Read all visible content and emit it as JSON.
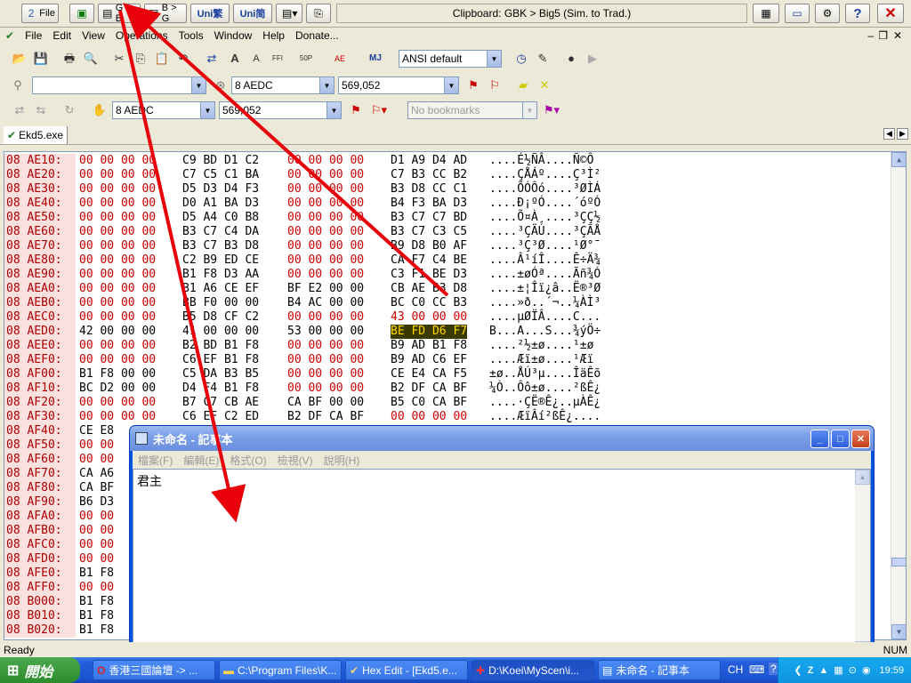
{
  "top_toolbar": {
    "buttons": [
      "File",
      "",
      "G > B",
      "B > G",
      "Uni繁",
      "Uni简",
      "",
      ""
    ],
    "clipboard_text": "Clipboard: GBK > Big5  (Sim. to Trad.)"
  },
  "menu": {
    "items": [
      "File",
      "Edit",
      "View",
      "Operations",
      "Tools",
      "Window",
      "Help",
      "Donate..."
    ]
  },
  "toolbar2": {
    "font_select": "ANSI default"
  },
  "toolbar3": {
    "combo1": "",
    "combo2": "8 AEDC",
    "combo3": "569,052"
  },
  "toolbar4": {
    "combo1": "8 AEDC",
    "combo2": "569,052",
    "bookmarks": "No bookmarks"
  },
  "tab": {
    "label": "Ekd5.exe"
  },
  "hex": {
    "rows": [
      {
        "addr": "08 AE10:",
        "g1": "00 00 00 00",
        "g2": "C9 BD D1 C2",
        "g3": "00 00 00 00",
        "g4": "D1 A9 D4 AD",
        "ascii": "....É½ÑÂ....Ñ©Ô­"
      },
      {
        "addr": "08 AE20:",
        "g1": "00 00 00 00",
        "g2": "C7 C5 C1 BA",
        "g3": "00 00 00 00",
        "g4": "C7 B3 CC B2",
        "ascii": "....ÇÅÁº....Ç³Ì²"
      },
      {
        "addr": "08 AE30:",
        "g1": "00 00 00 00",
        "g2": "D5 D3 D4 F3",
        "g3": "00 00 00 00",
        "g4": "B3 D8 CC C1",
        "ascii": "....ÕÓÔó....³ØÌÁ"
      },
      {
        "addr": "08 AE40:",
        "g1": "00 00 00 00",
        "g2": "D0 A1 BA D3",
        "g3": "00 00 00 00",
        "g4": "B4 F3 BA D3",
        "ascii": "....Ð¡ºÓ....´óºÓ"
      },
      {
        "addr": "08 AE50:",
        "g1": "00 00 00 00",
        "g2": "D5 A4 C0 B8",
        "g3": "00 00 00 00",
        "g4": "B3 C7 C7 BD",
        "ascii": "....Õ¤À¸....³ÇÇ½"
      },
      {
        "addr": "08 AE60:",
        "g1": "00 00 00 00",
        "g2": "B3 C7 C4 DA",
        "g3": "00 00 00 00",
        "g4": "B3 C7 C3 C5",
        "ascii": "....³ÇÄÚ....³ÇÃÅ"
      },
      {
        "addr": "08 AE70:",
        "g1": "00 00 00 00",
        "g2": "B3 C7 B3 D8",
        "g3": "00 00 00 00",
        "g4": "B9 D8 B0 AF",
        "ascii": "....³Ç³Ø....¹Ø°¯"
      },
      {
        "addr": "08 AE80:",
        "g1": "00 00 00 00",
        "g2": "C2 B9 ED CE",
        "g3": "00 00 00 00",
        "g4": "CA F7 C4 BE",
        "ascii": "....Â¹íÎ....Ê÷Ä¾"
      },
      {
        "addr": "08 AE90:",
        "g1": "00 00 00 00",
        "g2": "B1 F8 D3 AA",
        "g3": "00 00 00 00",
        "g4": "C3 F1 BE D3",
        "ascii": "....±øÓª....Ãñ¾Ó"
      },
      {
        "addr": "08 AEA0:",
        "g1": "00 00 00 00",
        "g2": "B1 A6 CE EF",
        "g3": "BF E2 00 00",
        "g4": "CB AE B3 D8",
        "ascii": "....±¦Îï¿â..Ë®³Ø"
      },
      {
        "addr": "08 AEB0:",
        "g1": "00 00 00 00",
        "g2": "BB F0 00 00",
        "g3": "B4 AC 00 00",
        "g4": "BC C0 CC B3",
        "ascii": "....»ð..´¬..¼ÀÌ³"
      },
      {
        "addr": "08 AEC0:",
        "g1": "00 00 00 00",
        "g2": "B5 D8 CF C2",
        "g3": "00 00 00 00",
        "g4": "43 00 00 00",
        "ascii": "....µØÏÂ....C..."
      },
      {
        "addr": "08 AED0:",
        "g1": "42 00 00 00",
        "g2": "41 00 00 00",
        "g3": "53 00 00 00",
        "g4": "BE FD D6 F7",
        "ascii": "B...A...S...¾ýÖ÷",
        "hl": true
      },
      {
        "addr": "08 AEE0:",
        "g1": "00 00 00 00",
        "g2": "B2 BD B1 F8",
        "g3": "00 00 00 00",
        "g4": "B9 AD B1 F8",
        "ascii": "....²½±ø....¹­±ø"
      },
      {
        "addr": "08 AEF0:",
        "g1": "00 00 00 00",
        "g2": "C6 EF B1 F8",
        "g3": "00 00 00 00",
        "g4": "B9 AD C6 EF",
        "ascii": "....Æï±ø....¹­Æï"
      },
      {
        "addr": "08 AF00:",
        "g1": "B1 F8 00 00",
        "g2": "C5 DA B3 B5",
        "g3": "00 00 00 00",
        "g4": "CE E4 CA F5",
        "ascii": "±ø..ÅÚ³µ....ÎäÊõ"
      },
      {
        "addr": "08 AF10:",
        "g1": "BC D2 00 00",
        "g2": "D4 F4 B1 F8",
        "g3": "00 00 00 00",
        "g4": "B2 DF CA BF",
        "ascii": "¼Ò..Ôô±ø....²ßÊ¿"
      },
      {
        "addr": "08 AF20:",
        "g1": "00 00 00 00",
        "g2": "B7 C7 CB AE",
        "g3": "CA BF 00 00",
        "g4": "B5 C0 CA BF",
        "ascii": "....·ÇË®Ê¿..µÀÊ¿"
      },
      {
        "addr": "08 AF30:",
        "g1": "00 00 00 00",
        "g2": "C6 EF C2 ED",
        "g3": "B2 DF CA BF",
        "g4": "00 00 00 00",
        "ascii": "....ÆïÂí²ßÊ¿...."
      },
      {
        "addr": "08 AF40:",
        "g1": "CE E8",
        "g2": "",
        "g3": "",
        "g4": "",
        "ascii": ""
      },
      {
        "addr": "08 AF50:",
        "g1": "00 00",
        "g2": "",
        "g3": "",
        "g4": "",
        "ascii": ""
      },
      {
        "addr": "08 AF60:",
        "g1": "00 00",
        "g2": "",
        "g3": "",
        "g4": "",
        "ascii": ""
      },
      {
        "addr": "08 AF70:",
        "g1": "CA A6",
        "g2": "",
        "g3": "",
        "g4": "",
        "ascii": ""
      },
      {
        "addr": "08 AF80:",
        "g1": "CA BF",
        "g2": "",
        "g3": "",
        "g4": "",
        "ascii": ""
      },
      {
        "addr": "08 AF90:",
        "g1": "B6 D3",
        "g2": "",
        "g3": "",
        "g4": "",
        "ascii": ""
      },
      {
        "addr": "08 AFA0:",
        "g1": "00 00",
        "g2": "",
        "g3": "",
        "g4": "",
        "ascii": ""
      },
      {
        "addr": "08 AFB0:",
        "g1": "00 00",
        "g2": "",
        "g3": "",
        "g4": "",
        "ascii": ""
      },
      {
        "addr": "08 AFC0:",
        "g1": "00 00",
        "g2": "",
        "g3": "",
        "g4": "",
        "ascii": ""
      },
      {
        "addr": "08 AFD0:",
        "g1": "00 00",
        "g2": "",
        "g3": "",
        "g4": "",
        "ascii": ""
      },
      {
        "addr": "08 AFE0:",
        "g1": "B1 F8",
        "g2": "",
        "g3": "",
        "g4": "",
        "ascii": ""
      },
      {
        "addr": "08 AFF0:",
        "g1": "00 00",
        "g2": "",
        "g3": "",
        "g4": "",
        "ascii": ""
      },
      {
        "addr": "08 B000:",
        "g1": "B1 F8",
        "g2": "",
        "g3": "",
        "g4": "",
        "ascii": ""
      },
      {
        "addr": "08 B010:",
        "g1": "B1 F8",
        "g2": "",
        "g3": "",
        "g4": "",
        "ascii": ""
      },
      {
        "addr": "08 B020:",
        "g1": "B1 F8",
        "g2": "",
        "g3": "",
        "g4": "",
        "ascii": ""
      }
    ]
  },
  "notepad": {
    "title": "未命名 - 記事本",
    "menu": [
      "檔案(F)",
      "編輯(E)",
      "格式(O)",
      "檢視(V)",
      "說明(H)"
    ],
    "content": "君主"
  },
  "status": {
    "left": "Ready",
    "right": "NUM"
  },
  "taskbar": {
    "start": "開始",
    "tasks": [
      "香港三國論壇 -> ...",
      "C:\\Program Files\\K...",
      "Hex Edit - [Ekd5.e...",
      "D:\\Koei\\MyScen\\i...",
      "未命名 - 記事本"
    ],
    "tray_ime": "CH",
    "clock": "19:59"
  },
  "colors": {
    "arrow": "#e8000a",
    "highlight_bg": "#3a3a00",
    "highlight_fg": "#ffd700"
  }
}
